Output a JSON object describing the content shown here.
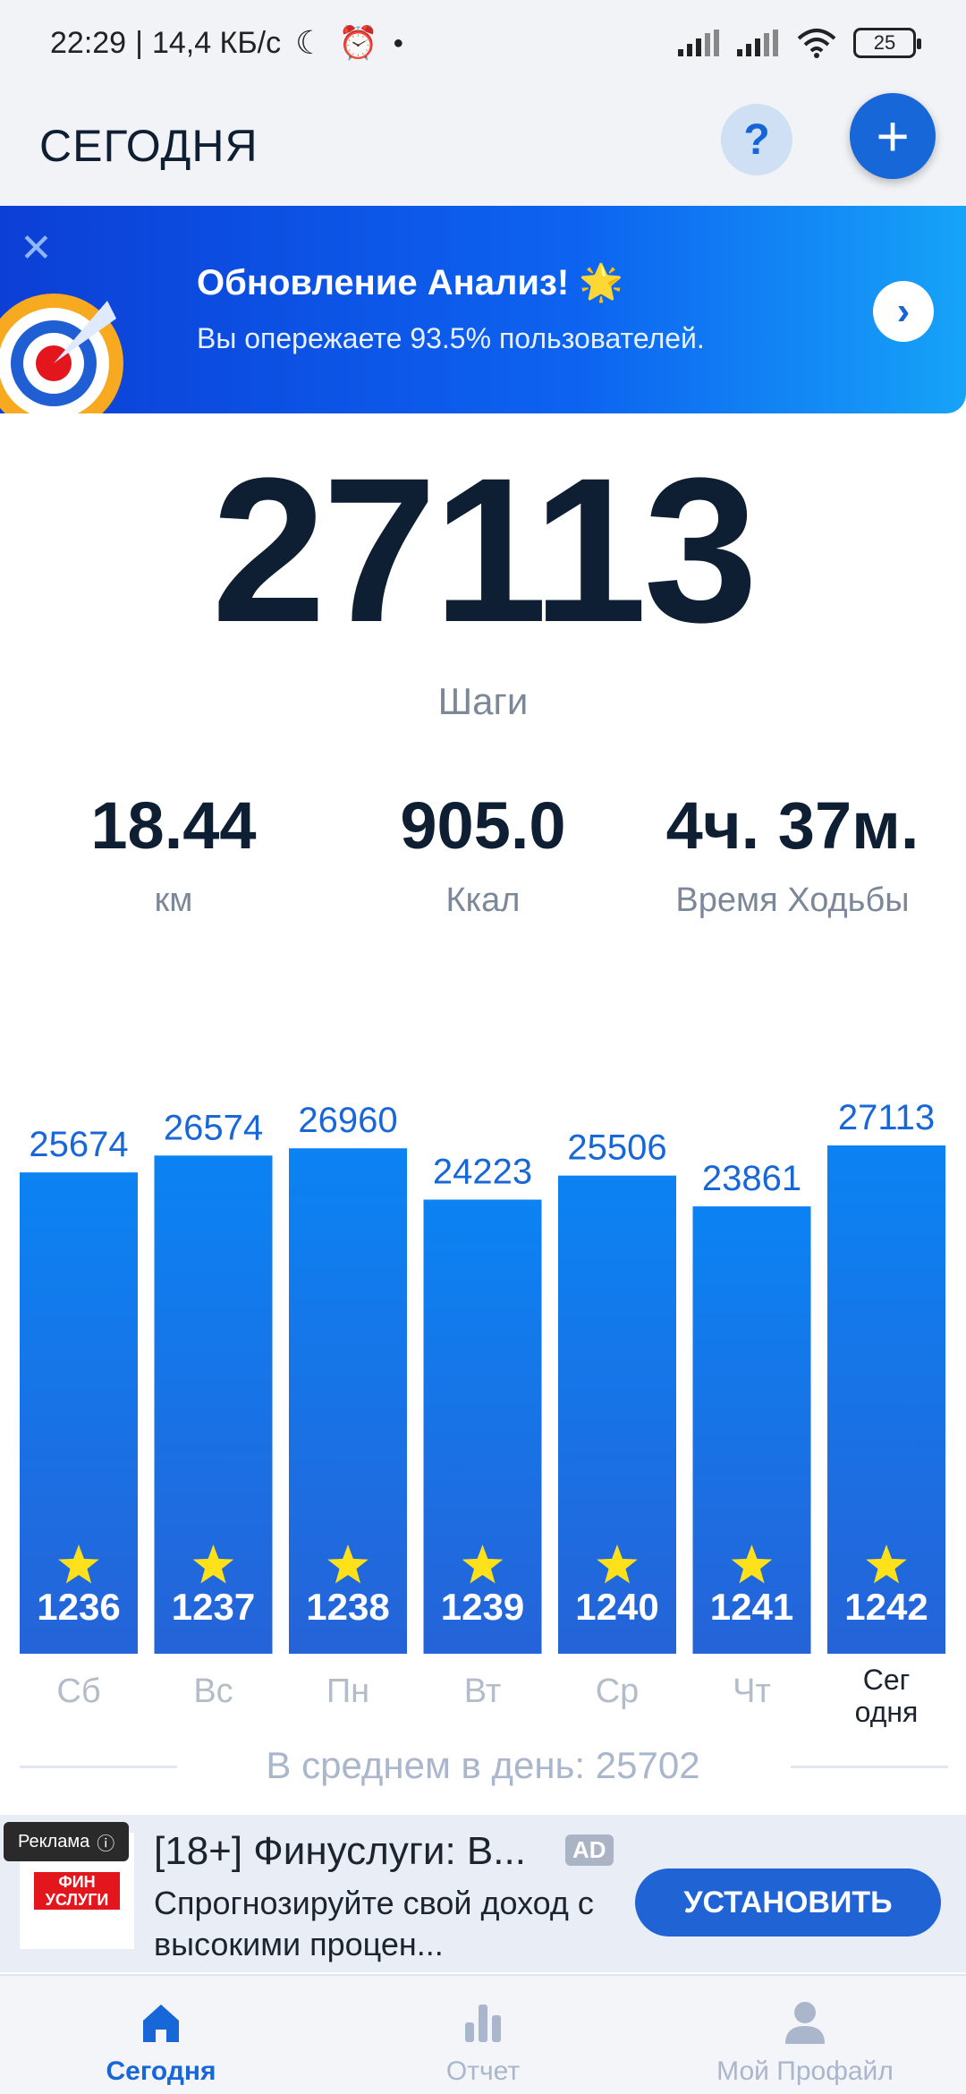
{
  "status": {
    "time": "22:29",
    "speed": "14,4 КБ/с",
    "battery": "25"
  },
  "header": {
    "title": "СЕГОДНЯ",
    "help_label": "?",
    "add_label": "+"
  },
  "banner": {
    "title": "Обновление Анализ! 🌟",
    "subtitle": "Вы опережаете 93.5% пользователей."
  },
  "steps": {
    "value": "27113",
    "label": "Шаги"
  },
  "stats": [
    {
      "value": "18.44",
      "label": "км"
    },
    {
      "value": "905.0",
      "label": "Ккал"
    },
    {
      "value": "4ч. 37м.",
      "label": "Время Ходьбы"
    }
  ],
  "chart_data": {
    "type": "bar",
    "categories": [
      "Сб",
      "Вс",
      "Пн",
      "Вт",
      "Ср",
      "Чт",
      "Сегодня"
    ],
    "category_labels": [
      [
        "Сб"
      ],
      [
        "Вс"
      ],
      [
        "Пн"
      ],
      [
        "Вт"
      ],
      [
        "Ср"
      ],
      [
        "Чт"
      ],
      [
        "Сег",
        "одня"
      ]
    ],
    "values": [
      25674,
      26574,
      26960,
      24223,
      25506,
      23861,
      27113
    ],
    "inner_labels": [
      "1236",
      "1237",
      "1238",
      "1239",
      "1240",
      "1241",
      "1242"
    ],
    "active_index": 6,
    "ylim": [
      0,
      27113
    ],
    "colors": {
      "bar_top": "#0b83f3",
      "bar_bottom": "#2563d8",
      "value_label": "#1867d8",
      "star": "#ffe11b"
    }
  },
  "average": {
    "text": "В среднем в день: 25702"
  },
  "ad": {
    "badge": "Реклама",
    "logo_text_1": "ФИН",
    "logo_text_2": "УСЛУГИ",
    "title": "[18+] Финуслуги: В...",
    "tag": "AD",
    "description": "Спрогнозируйте свой доход с высокими процен...",
    "install_label": "УСТАНОВИТЬ"
  },
  "nav": {
    "items": [
      {
        "label": "Сегодня"
      },
      {
        "label": "Отчет"
      },
      {
        "label": "Мой Профайл"
      }
    ]
  },
  "colors": {
    "accent": "#1867d8",
    "text_dark": "#0e1e33",
    "text_muted": "#7c8898"
  }
}
